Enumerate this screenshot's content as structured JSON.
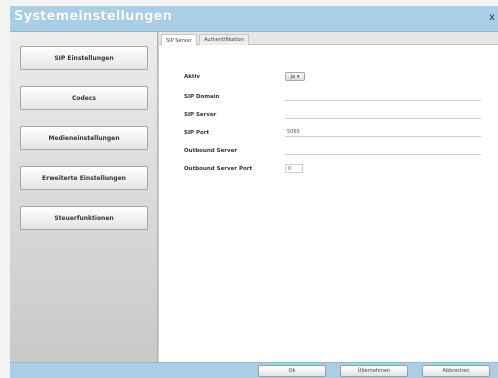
{
  "window": {
    "title": "Systemeinstellungen",
    "close_glyph": "x"
  },
  "sidebar": {
    "items": [
      {
        "label": "SIP Einstellungen"
      },
      {
        "label": "Codecs"
      },
      {
        "label": "Medieneinstellungen"
      },
      {
        "label": "Erweiterte Einstellungen"
      },
      {
        "label": "Steuerfunktionen"
      }
    ]
  },
  "tabs": [
    {
      "label": "SIP Server",
      "active": true
    },
    {
      "label": "Authentifikation",
      "active": false
    }
  ],
  "form": {
    "aktiv": {
      "label": "Aktiv",
      "value": "Ja"
    },
    "sip_domain": {
      "label": "SIP Domain",
      "value": ""
    },
    "sip_server": {
      "label": "SIP Server",
      "value": ""
    },
    "sip_port": {
      "label": "SIP Port",
      "value": "5060"
    },
    "outbound_server": {
      "label": "Outbound Server",
      "value": ""
    },
    "outbound_server_port": {
      "label": "Outbound Server Port",
      "value": "0"
    }
  },
  "footer": {
    "ok_label": "Ok",
    "apply_label": "Übernehmen",
    "cancel_label": "Abbrechen"
  },
  "icons": {
    "dropdown": "chevron-down-icon",
    "close": "close-icon"
  },
  "colors": {
    "titlebar": "#a9cfe6",
    "footer": "#a9cfe6"
  }
}
